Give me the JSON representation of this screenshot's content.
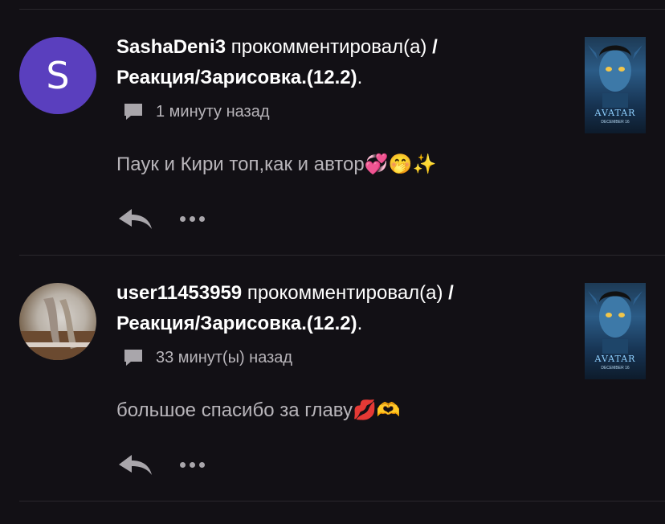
{
  "colors": {
    "background": "#121015",
    "avatar_letter_bg": "#5a3fbe",
    "muted_text": "#b8b5ba",
    "divider": "#2a272d"
  },
  "comments": [
    {
      "avatar_letter": "S",
      "username": "SashaDeni3",
      "action": "прокомментировал(а)",
      "separator": "/",
      "work_title": "Реакция/Зарисовка.(12.2)",
      "title_end": ".",
      "time": "1 минуту назад",
      "text": "Паук и Кири топ,как и автор💞🤭✨",
      "thumb_title": "AVATAR",
      "thumb_sub": "DECEMBER 16",
      "icons": [
        "comment-icon",
        "reply-icon",
        "more-icon"
      ]
    },
    {
      "avatar_letter": "",
      "username": "user11453959",
      "action": "прокомментировал(а)",
      "separator": "/",
      "work_title": "Реакция/Зарисовка.(12.2)",
      "title_end": ".",
      "time": "33 минут(ы) назад",
      "text": "большое спасибо за главу💋🫶",
      "thumb_title": "AVATAR",
      "thumb_sub": "DECEMBER 16",
      "icons": [
        "comment-icon",
        "reply-icon",
        "more-icon"
      ]
    }
  ]
}
